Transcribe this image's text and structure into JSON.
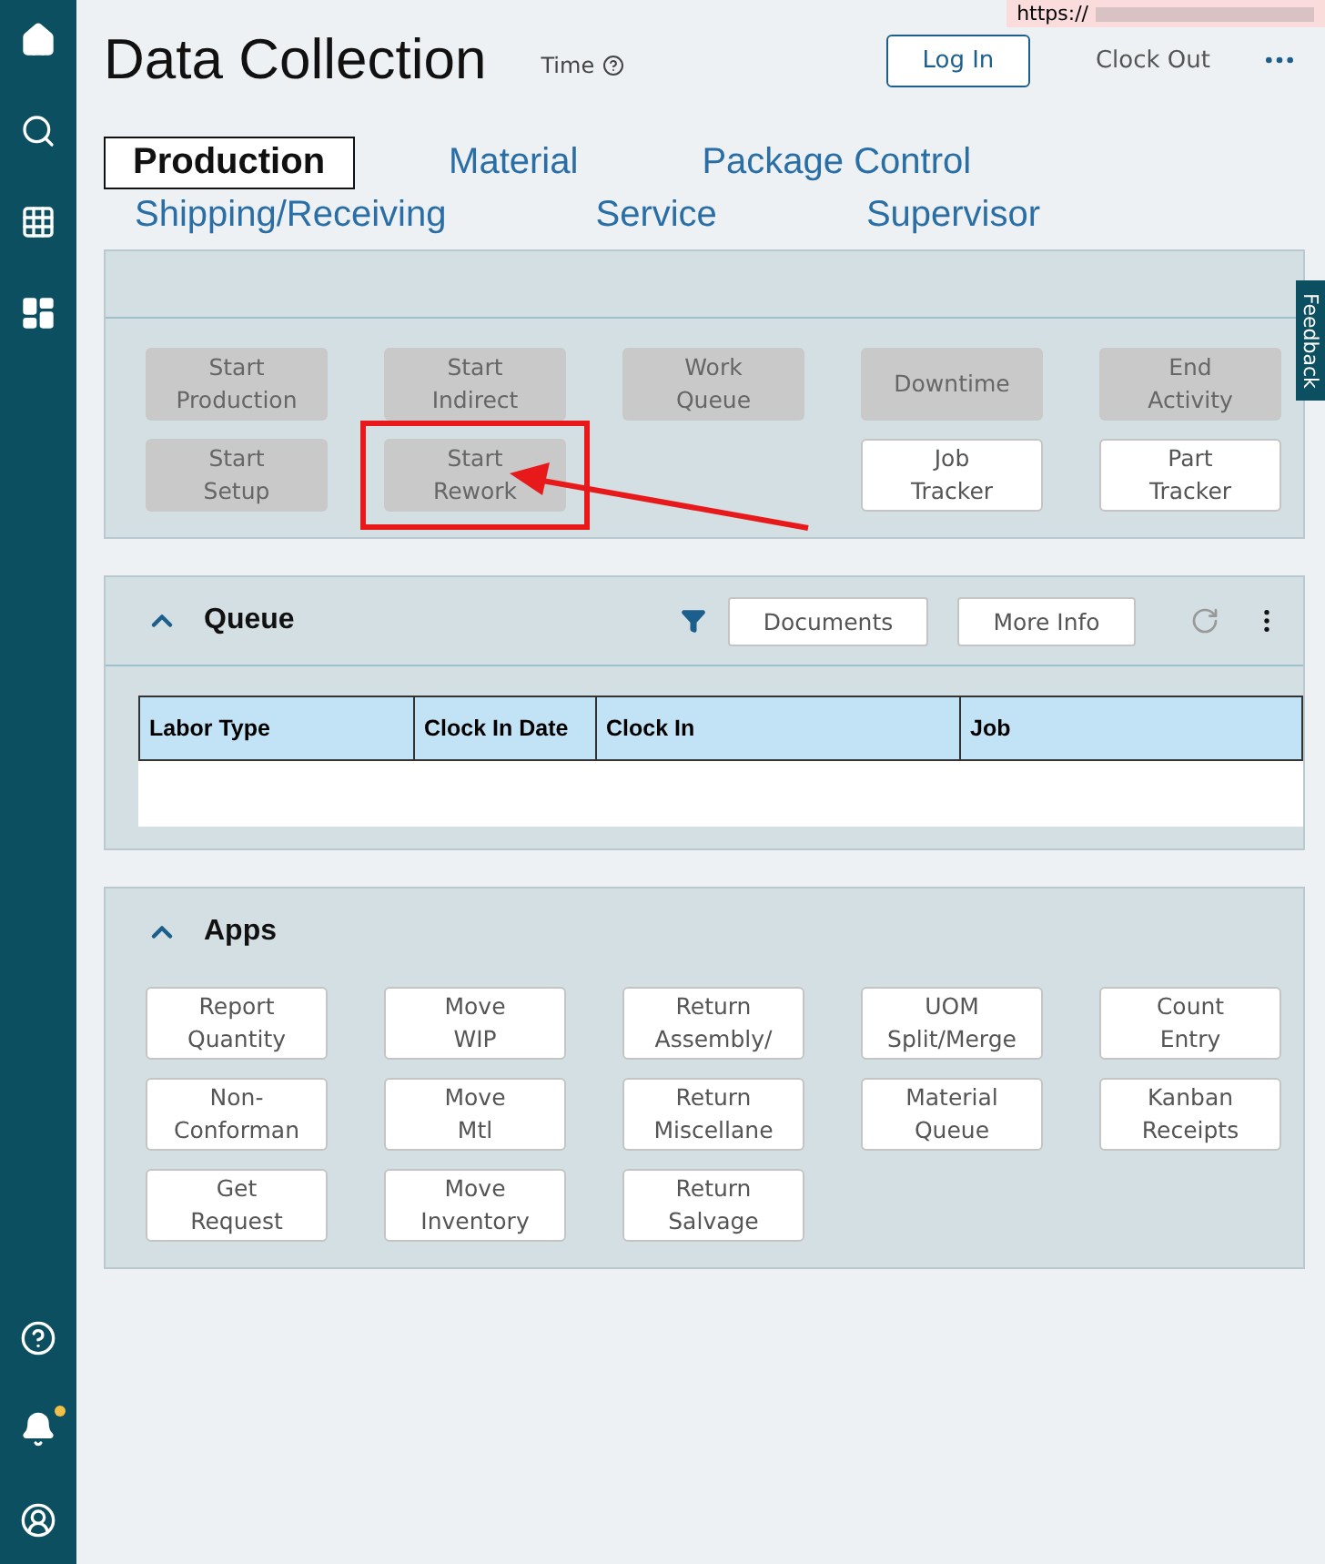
{
  "url_tooltip": "https://",
  "notification_dot": true,
  "header": {
    "title": "Data Collection",
    "time_label": "Time",
    "login": "Log In",
    "clock_out": "Clock Out"
  },
  "tab_rows": [
    [
      {
        "label": "Production",
        "selected": true
      },
      {
        "label": "Material",
        "selected": false
      },
      {
        "label": "Package Control",
        "selected": false
      }
    ],
    [
      {
        "label": "Shipping/Receiving",
        "selected": false
      },
      {
        "label": "Service",
        "selected": false
      },
      {
        "label": "Supervisor",
        "selected": false
      }
    ]
  ],
  "feedback": "Feedback",
  "menu_buttons": [
    {
      "label": "Start\nProduction",
      "disabled": true,
      "highlighted": false
    },
    {
      "label": "Start\nIndirect",
      "disabled": true,
      "highlighted": false
    },
    {
      "label": "Work\nQueue",
      "disabled": true,
      "highlighted": false
    },
    {
      "label": "Downtime",
      "disabled": true,
      "highlighted": false
    },
    {
      "label": "End\nActivity",
      "disabled": true,
      "highlighted": false
    },
    {
      "label": "Start\nSetup",
      "disabled": true,
      "highlighted": false
    },
    {
      "label": "Start\nRework",
      "disabled": true,
      "highlighted": true
    },
    {
      "label": "Job\nTracker",
      "disabled": false,
      "highlighted": false
    },
    {
      "label": "Part\nTracker",
      "disabled": false,
      "highlighted": false
    }
  ],
  "queue": {
    "title": "Queue",
    "expanded": true,
    "buttons": [
      "Documents",
      "More Info"
    ],
    "columns": [
      "Labor Type",
      "Clock In Date",
      "Clock In",
      "Job"
    ]
  },
  "apps": {
    "title": "Apps",
    "expanded": true,
    "buttons": [
      "Report\nQuantity",
      "Move\nWIP",
      "Return\nAssembly/",
      "UOM\nSplit/Merge",
      "Count\nEntry",
      "Non-\nConforman",
      "Move\nMtl",
      "Return\nMiscellane",
      "Material\nQueue",
      "Kanban\nReceipts",
      "Get\nRequest",
      "Move\nInventory",
      "Return\nSalvage"
    ]
  }
}
